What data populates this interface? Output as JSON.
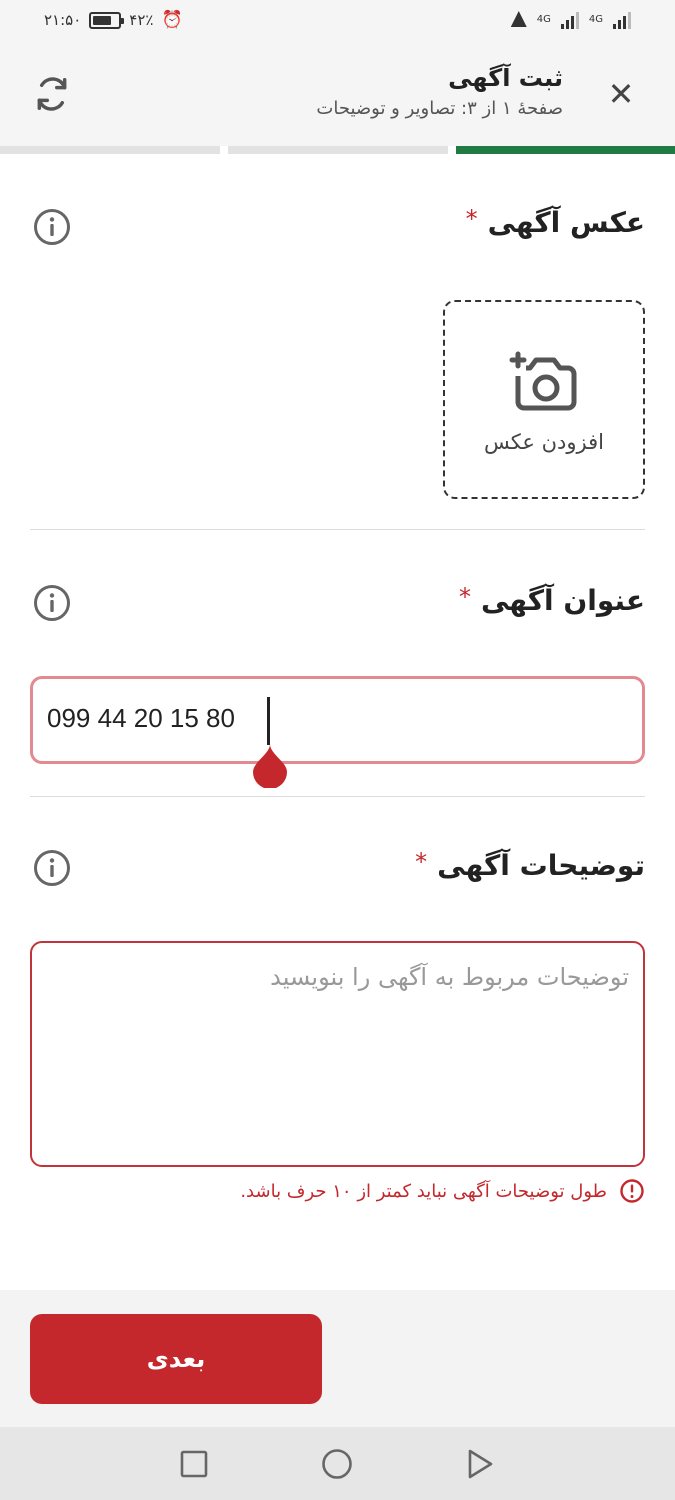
{
  "status_bar": {
    "time": "۲۱:۵۰",
    "battery_percent": "۴۲٪",
    "network_1": "4G",
    "network_2": "4G"
  },
  "header": {
    "title": "ثبت آگهی",
    "subtitle": "صفحهٔ ۱ از ۳: تصاویر و توضیحات",
    "close_icon": "✕"
  },
  "progress": {
    "total_steps": 3,
    "current_step": 1
  },
  "photo_section": {
    "title": "عکس آگهی",
    "required_mark": "*",
    "add_photo_label": "افزودن عکس"
  },
  "title_section": {
    "title": "عنوان آگهی",
    "required_mark": "*",
    "input_value": "099 44 20 15 80"
  },
  "description_section": {
    "title": "توضیحات آگهی",
    "required_mark": "*",
    "placeholder": "توضیحات مربوط به آگهی را بنویسید",
    "error_text": "طول توضیحات آگهی نباید کمتر از ۱۰ حرف باشد."
  },
  "actions": {
    "next_label": "بعدی"
  },
  "colors": {
    "accent": "#c4282d",
    "progress_active": "#1f7a43",
    "error_border": "#c0343a",
    "focus_border": "#e38a90"
  }
}
